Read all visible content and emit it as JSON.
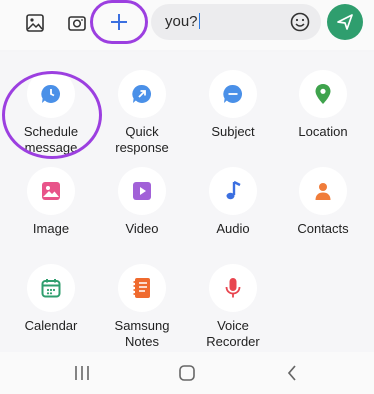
{
  "compose": {
    "message_text": "you?"
  },
  "colors": {
    "highlight": "#9c3fe0",
    "send": "#2f9e6e",
    "blue_icon": "#3b8ee8"
  },
  "attachments": [
    {
      "label": "Schedule\nmessage",
      "icon": "schedule-clock-icon"
    },
    {
      "label": "Quick\nresponse",
      "icon": "quick-response-icon"
    },
    {
      "label": "Subject",
      "icon": "subject-icon"
    },
    {
      "label": "Location",
      "icon": "location-pin-icon"
    },
    {
      "label": "Image",
      "icon": "image-icon"
    },
    {
      "label": "Video",
      "icon": "video-icon"
    },
    {
      "label": "Audio",
      "icon": "audio-note-icon"
    },
    {
      "label": "Contacts",
      "icon": "contacts-icon"
    },
    {
      "label": "Calendar",
      "icon": "calendar-icon"
    },
    {
      "label": "Samsung\nNotes",
      "icon": "samsung-notes-icon"
    },
    {
      "label": "Voice\nRecorder",
      "icon": "voice-recorder-icon"
    }
  ],
  "navbar": [
    "recents-icon",
    "home-icon",
    "back-icon"
  ]
}
